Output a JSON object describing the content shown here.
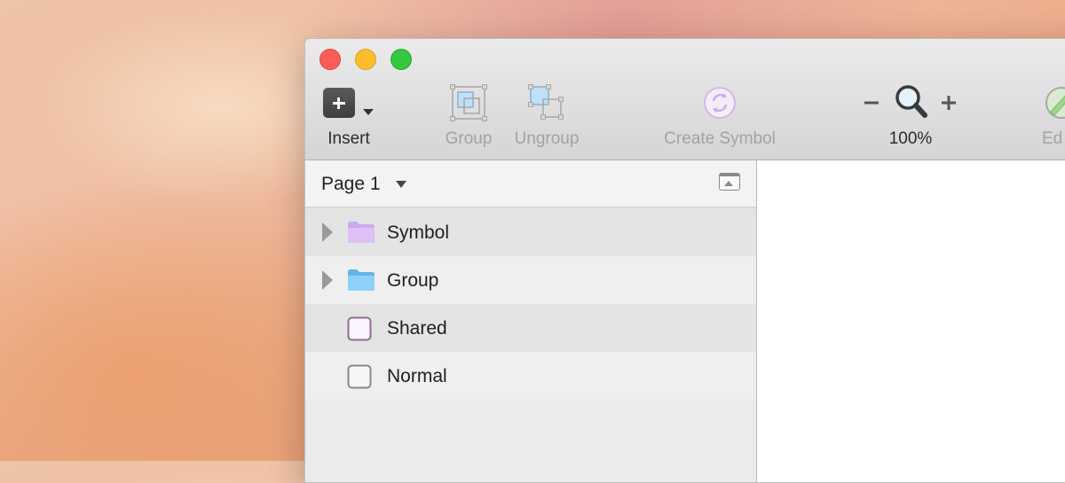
{
  "toolbar": {
    "insert_label": "Insert",
    "group_label": "Group",
    "ungroup_label": "Ungroup",
    "create_symbol_label": "Create Symbol",
    "zoom_label": "100%",
    "edit_label": "Ed"
  },
  "sidebar": {
    "page_name": "Page 1",
    "layers": [
      {
        "label": "Symbol",
        "kind": "folder",
        "color": "#cfa9f0"
      },
      {
        "label": "Group",
        "kind": "folder",
        "color": "#74c6f5"
      },
      {
        "label": "Shared",
        "kind": "shared-shape"
      },
      {
        "label": "Normal",
        "kind": "shape"
      }
    ]
  },
  "colors": {
    "close": "#fc5d56",
    "minimize": "#fdbc2e",
    "maximize": "#34c73f",
    "symbol_accent": "#cfa9f0",
    "group_accent": "#74c6f5"
  }
}
